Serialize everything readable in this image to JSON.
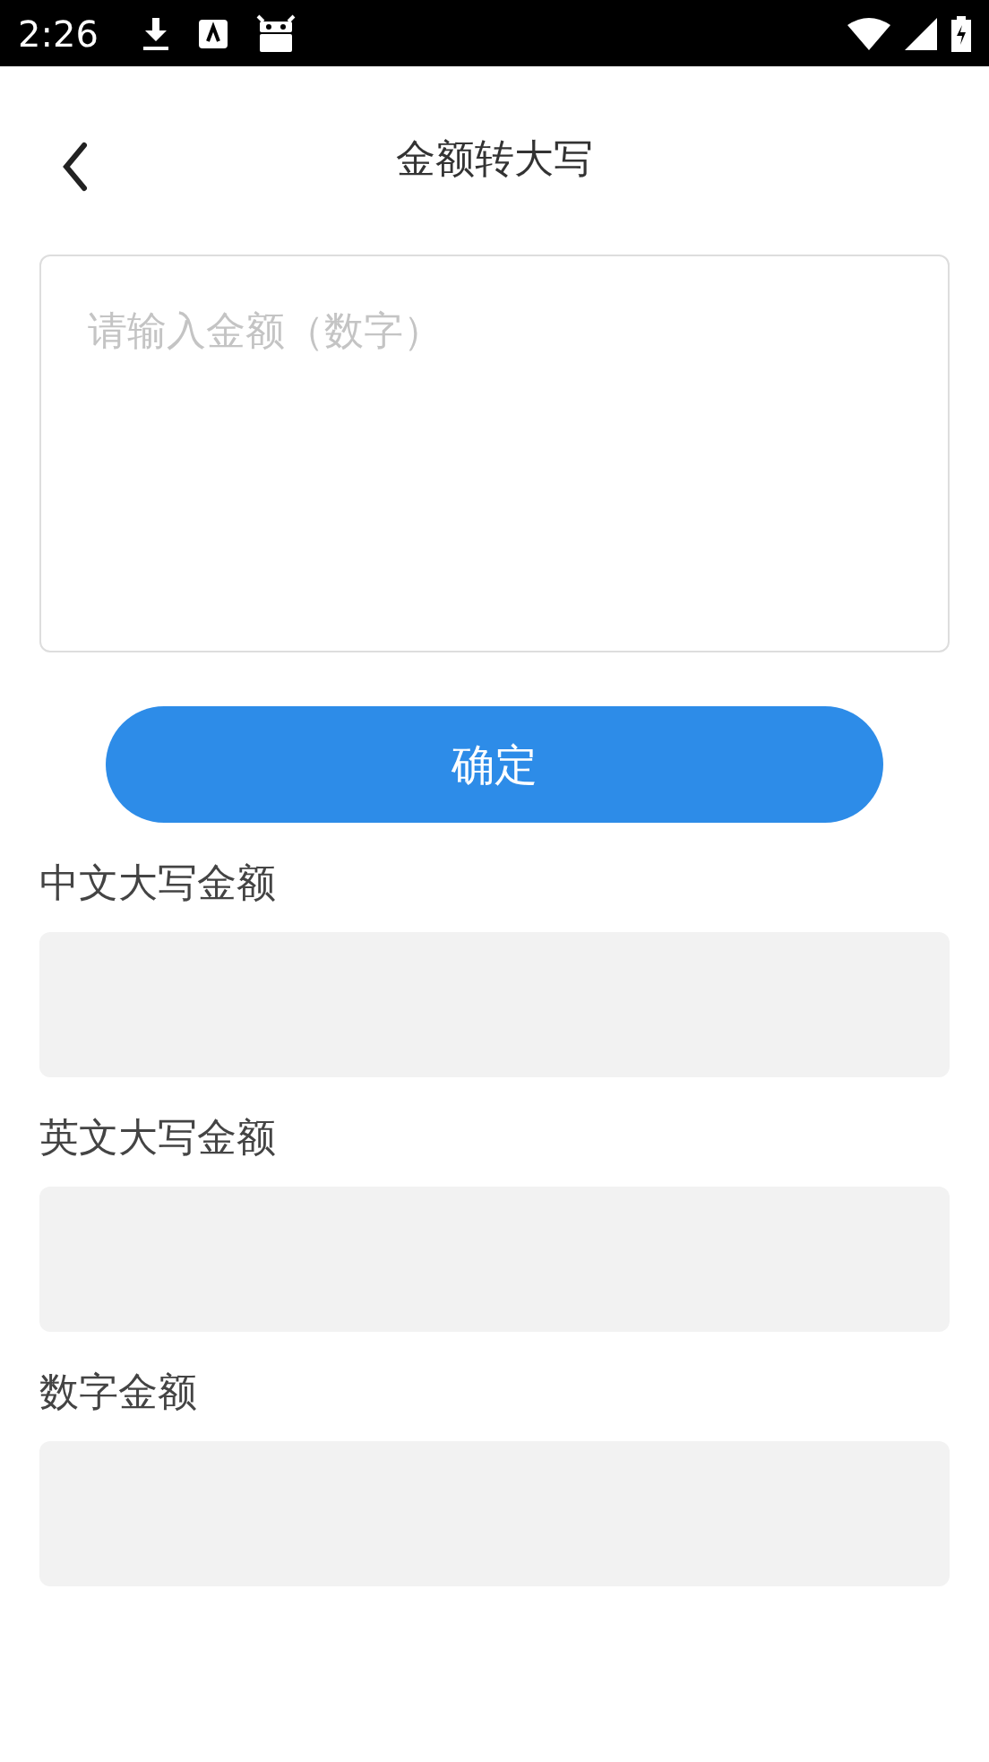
{
  "status_bar": {
    "time": "2:26"
  },
  "header": {
    "title": "金额转大写"
  },
  "amount_input": {
    "placeholder": "请输入金额（数字）"
  },
  "confirm_button": {
    "label": "确定"
  },
  "results": [
    {
      "label": "中文大写金额"
    },
    {
      "label": "英文大写金额"
    },
    {
      "label": "数字金额"
    }
  ]
}
